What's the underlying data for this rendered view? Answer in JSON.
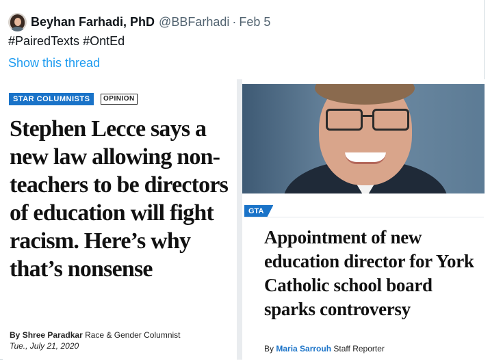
{
  "tweet": {
    "author_name": "Beyhan Farhadi, PhD",
    "handle": "@BBFarhadi",
    "separator": "·",
    "date": "Feb 5",
    "hashtags": [
      "#PairedTexts",
      "#OntEd"
    ],
    "show_thread": "Show this thread"
  },
  "left_article": {
    "section_badge": "STAR COLUMNISTS",
    "opinion_badge": "OPINION",
    "headline": "Stephen Lecce says a new law allowing non-teachers to be directors of education will fight racism. Here’s why that’s nonsense",
    "byline_prefix": "By",
    "author": "Shree Paradkar",
    "author_role": "Race & Gender Columnist",
    "date": "Tue., July 21, 2020"
  },
  "right_article": {
    "section_badge": "GTA",
    "headline": "Appointment of new education director for York Catholic school board sparks controversy",
    "byline_prefix": "By",
    "author": "Maria Sarrouh",
    "author_role": "Staff Reporter"
  },
  "colors": {
    "link_blue": "#1d9bf0",
    "star_blue": "#1a73c8",
    "text_dark": "#0f1419",
    "text_muted": "#536471"
  }
}
